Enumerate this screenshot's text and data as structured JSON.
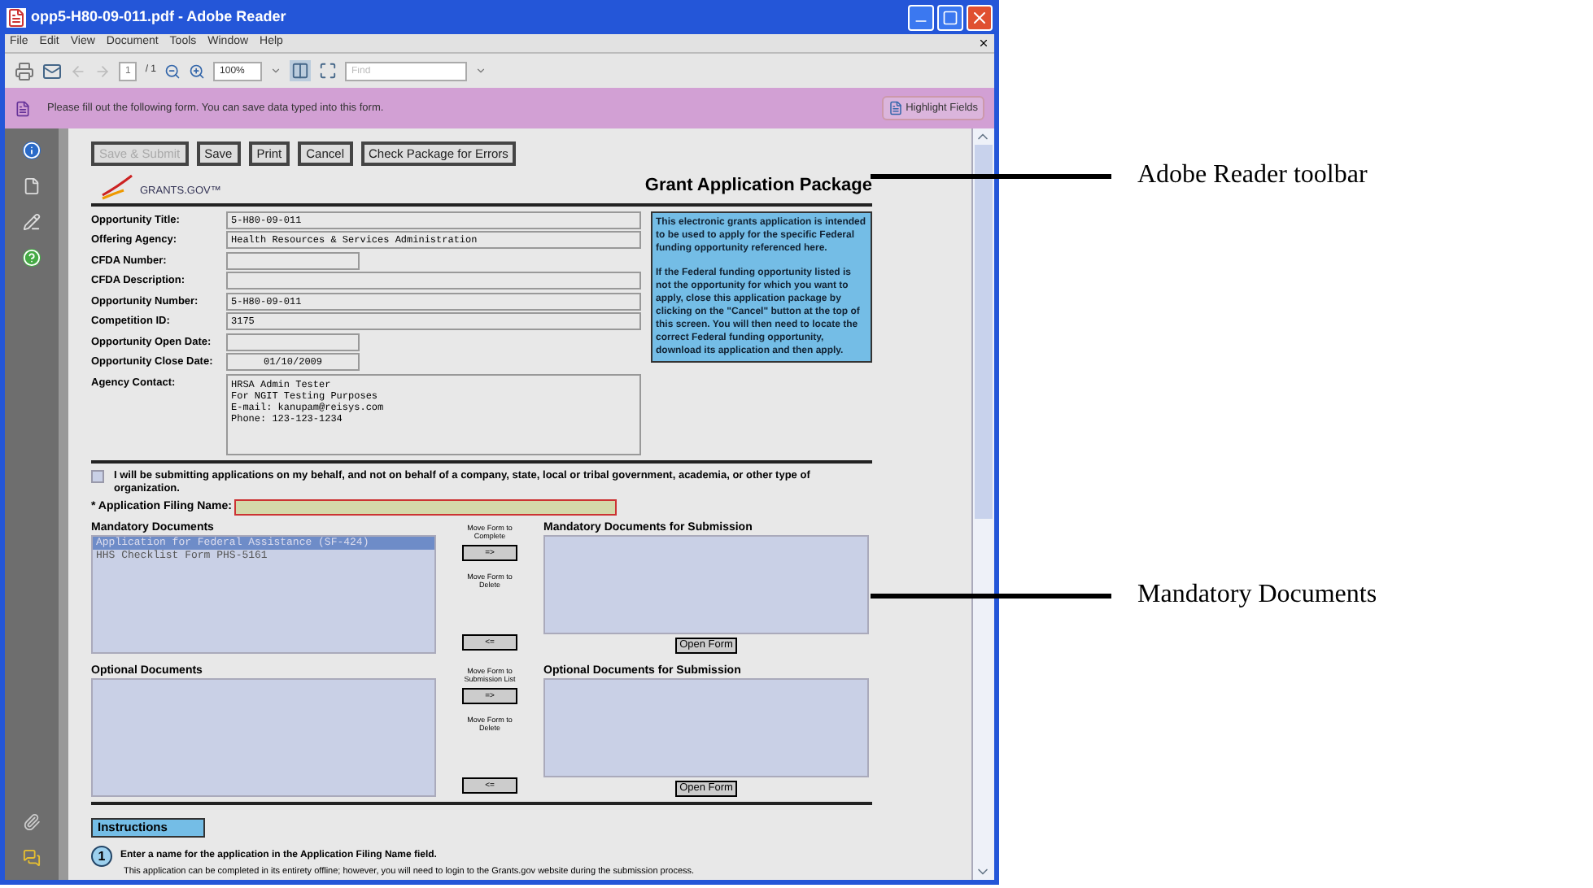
{
  "window": {
    "title": "opp5-H80-09-011.pdf - Adobe Reader"
  },
  "menu": [
    "File",
    "Edit",
    "View",
    "Document",
    "Tools",
    "Window",
    "Help"
  ],
  "toolbar": {
    "page": "1",
    "page_total": "/ 1",
    "zoom": "100%",
    "find_placeholder": "Find"
  },
  "form_bar": {
    "message": "Please fill out the following form. You can save data typed into this form.",
    "highlight_button": "Highlight Fields"
  },
  "form_buttons": [
    {
      "label": "Save & Submit",
      "disabled": true
    },
    {
      "label": "Save",
      "disabled": false
    },
    {
      "label": "Print",
      "disabled": false
    },
    {
      "label": "Cancel",
      "disabled": false
    },
    {
      "label": "Check Package for Errors",
      "disabled": false
    }
  ],
  "logo": "GRANTS.GOV™",
  "heading": "Grant Application Package",
  "fields": [
    {
      "label": "Opportunity Title:",
      "value": "5-H80-09-011",
      "kind": "wide"
    },
    {
      "label": "Offering Agency:",
      "value": "Health Resources & Services Administration",
      "kind": "wide"
    },
    {
      "label": "CFDA Number:",
      "kind": "short"
    },
    {
      "label": "CFDA Description:",
      "kind": "wide"
    },
    {
      "label": "Opportunity Number:",
      "value": "5-H80-09-011",
      "kind": "wide"
    },
    {
      "label": "Competition ID:",
      "value": "3175",
      "kind": "wide"
    },
    {
      "label": "Opportunity Open Date:",
      "kind": "short"
    },
    {
      "label": "Opportunity Close Date:",
      "value": "01/10/2009",
      "kind": "short"
    },
    {
      "label": "Agency Contact:",
      "value": "HRSA Admin Tester\nFor NGIT Testing Purposes\nE-mail: kanupam@reisys.com\nPhone: 123-123-1234",
      "kind": "area"
    }
  ],
  "info_box": [
    "This electronic grants application is intended to be used to apply for the specific Federal funding opportunity referenced here.",
    "If the Federal funding opportunity listed is not the opportunity for which you want to apply, close this application package by clicking on the \"Cancel\" button at the top of this screen. You will  then need to locate the correct Federal funding opportunity, download its application and then apply."
  ],
  "behalf": {
    "text": "I will be submitting applications on my behalf, and not on behalf of a company, state, local or tribal government, academia, or other type of organization.",
    "checked": false
  },
  "filing_name": {
    "label": "* Application Filing Name:"
  },
  "sections": [
    {
      "title": "Mandatory Documents",
      "items": [
        {
          "label": "Application for Federal Assistance (SF-424)",
          "selected": true
        },
        {
          "label": "HHS Checklist Form PHS-5161",
          "selected": false
        }
      ],
      "move_to": "Move Form to Complete",
      "move_to_button": "=>",
      "move_back": "Move Form to Delete",
      "move_back_button": "<=",
      "target_title": "Mandatory Documents for Submission",
      "open_button": "Open Form"
    },
    {
      "title": "Optional Documents",
      "move_to": "Move Form to Submission List",
      "move_to_button": "=>",
      "move_back": "Move Form to Delete",
      "move_back_button": "<=",
      "target_title": "Optional Documents for Submission",
      "open_button": "Open Form"
    }
  ],
  "instructions": {
    "title": "Instructions",
    "step": "1",
    "step_text": "Enter a name for the application in the Application Filing Name field.",
    "note": "This application can be completed in its entirety offline; however, you will need to login to the Grants.gov website during the submission process."
  },
  "callouts": [
    "Adobe Reader toolbar",
    "Mandatory Documents"
  ]
}
